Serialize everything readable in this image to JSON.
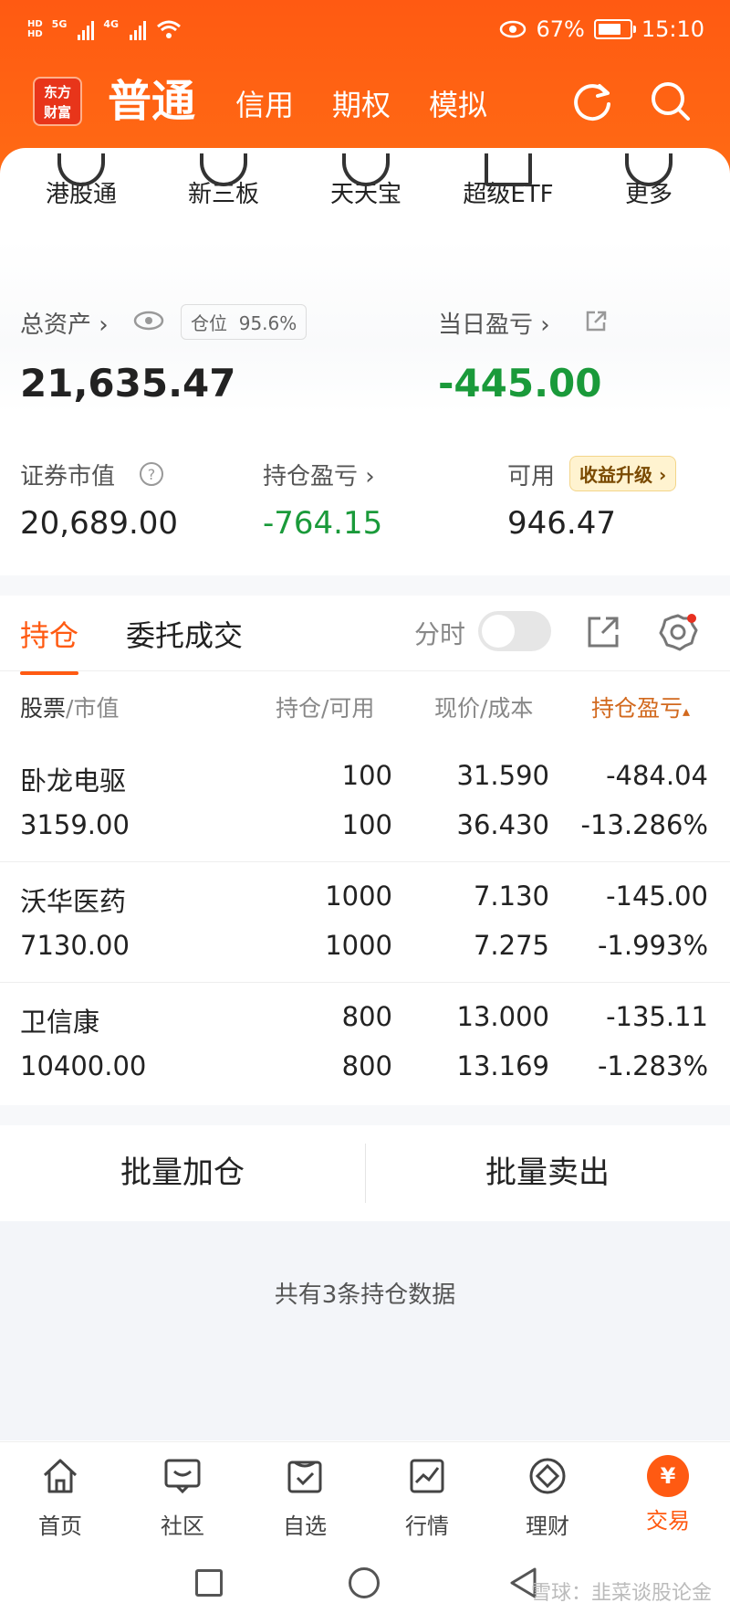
{
  "status_bar": {
    "hd_top": "HD",
    "hd_bottom": "HD",
    "net1": "5G",
    "net2": "4G",
    "battery_percent": "67%",
    "time": "15:10"
  },
  "header": {
    "logo_line1": "东方",
    "logo_line2": "财富",
    "tabs": [
      "普通",
      "信用",
      "期权",
      "模拟"
    ],
    "active_tab": "普通"
  },
  "shortcuts": [
    "港股通",
    "新三板",
    "天天宝",
    "超级ETF",
    "更多"
  ],
  "assets": {
    "total_label": "总资产",
    "position_label": "仓位",
    "position_value": "95.6%",
    "total_value": "21,635.47",
    "daily_pl_label": "当日盈亏",
    "daily_pl_value": "-445.00",
    "market_value_label": "证券市值",
    "market_value": "20,689.00",
    "holding_pl_label": "持仓盈亏",
    "holding_pl_value": "-764.15",
    "available_label": "可用",
    "available_badge": "收益升级",
    "available_value": "946.47"
  },
  "holdings_tabs": {
    "active": "持仓",
    "other": "委托成交",
    "fenshi_label": "分时"
  },
  "table": {
    "headers": {
      "stock": "股票",
      "stock_sub": "/市值",
      "position": "持仓/可用",
      "price": "现价/成本",
      "pl": "持仓盈亏"
    },
    "rows": [
      {
        "name": "卧龙电驱",
        "value": "3159.00",
        "hold": "100",
        "avail": "100",
        "price": "31.590",
        "cost": "36.430",
        "pl": "-484.04",
        "pl_pct": "-13.286%"
      },
      {
        "name": "沃华医药",
        "value": "7130.00",
        "hold": "1000",
        "avail": "1000",
        "price": "7.130",
        "cost": "7.275",
        "pl": "-145.00",
        "pl_pct": "-1.993%"
      },
      {
        "name": "卫信康",
        "value": "10400.00",
        "hold": "800",
        "avail": "800",
        "price": "13.000",
        "cost": "13.169",
        "pl": "-135.11",
        "pl_pct": "-1.283%"
      }
    ]
  },
  "batch": {
    "add_label": "批量加仓",
    "sell_label": "批量卖出"
  },
  "summary_text": "共有3条持仓数据",
  "tabbar": {
    "items": [
      "首页",
      "社区",
      "自选",
      "行情",
      "理财",
      "交易"
    ],
    "active": "交易",
    "trade_symbol": "¥"
  },
  "watermark": "雪球：韭菜谈股论金",
  "colors": {
    "brand": "#ff5a12",
    "loss": "#1a9a3a"
  }
}
